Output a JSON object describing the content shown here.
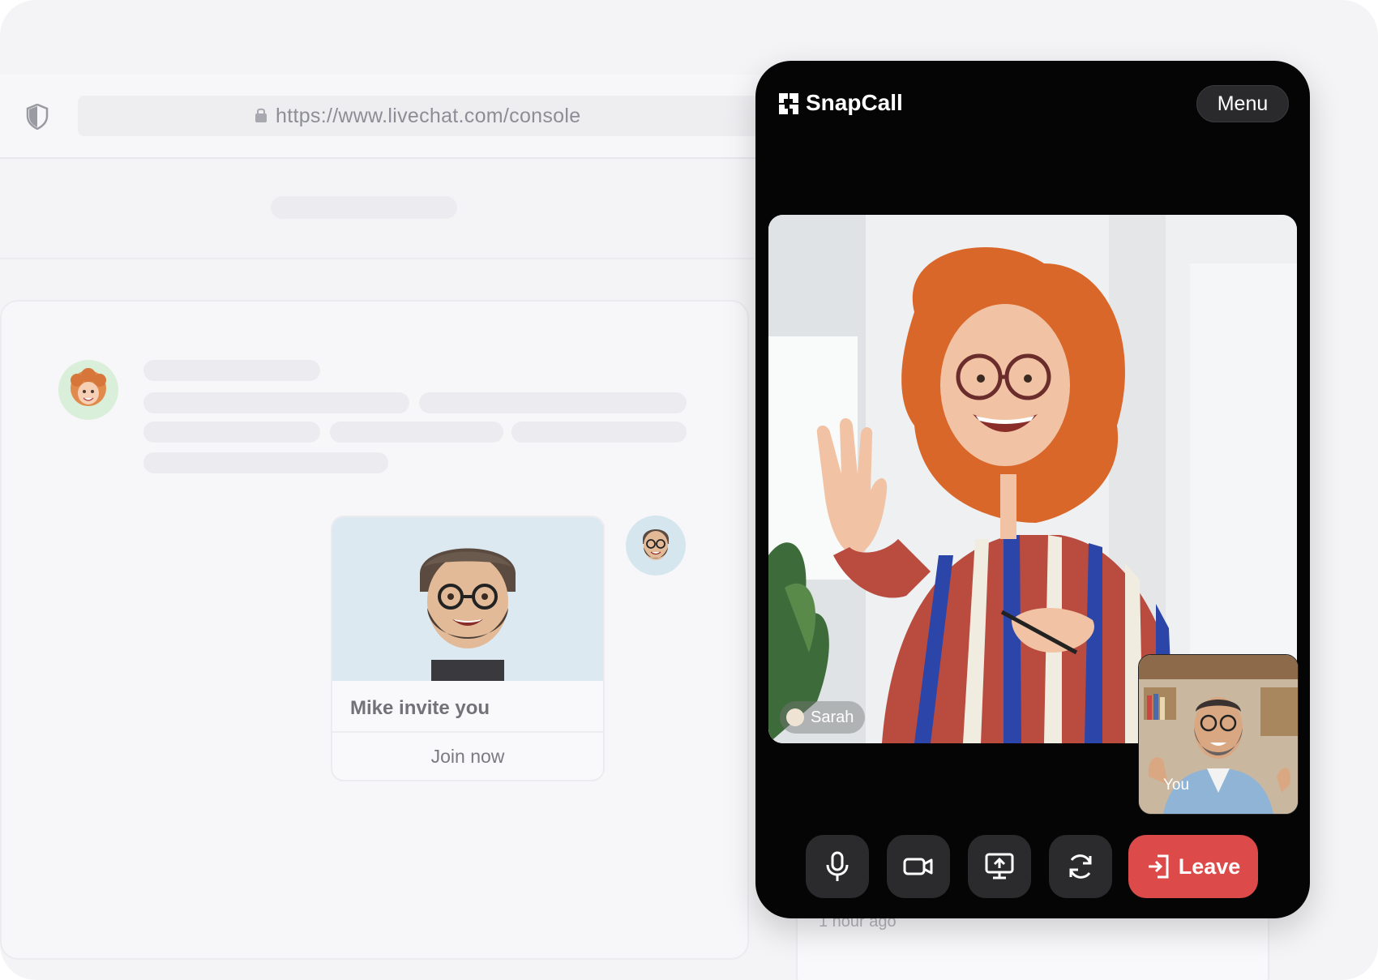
{
  "browser": {
    "url": "https://www.livechat.com/console"
  },
  "chat": {
    "invite_card": {
      "title": "Mike invite you",
      "join_label": "Join now"
    },
    "timestamp": "1 hour ago"
  },
  "widget": {
    "brand": "SnapCall",
    "menu_label": "Menu",
    "participants": {
      "remote_name": "Sarah",
      "self_name": "You"
    },
    "controls": {
      "microphone": "microphone-icon",
      "camera": "camera-icon",
      "screen_share": "screen-share-icon",
      "switch_camera": "refresh-icon",
      "leave_label": "Leave"
    }
  },
  "colors": {
    "widget_background": "#050505",
    "leave_button": "#dc4a4a",
    "control_button": "#2b2b2d"
  }
}
